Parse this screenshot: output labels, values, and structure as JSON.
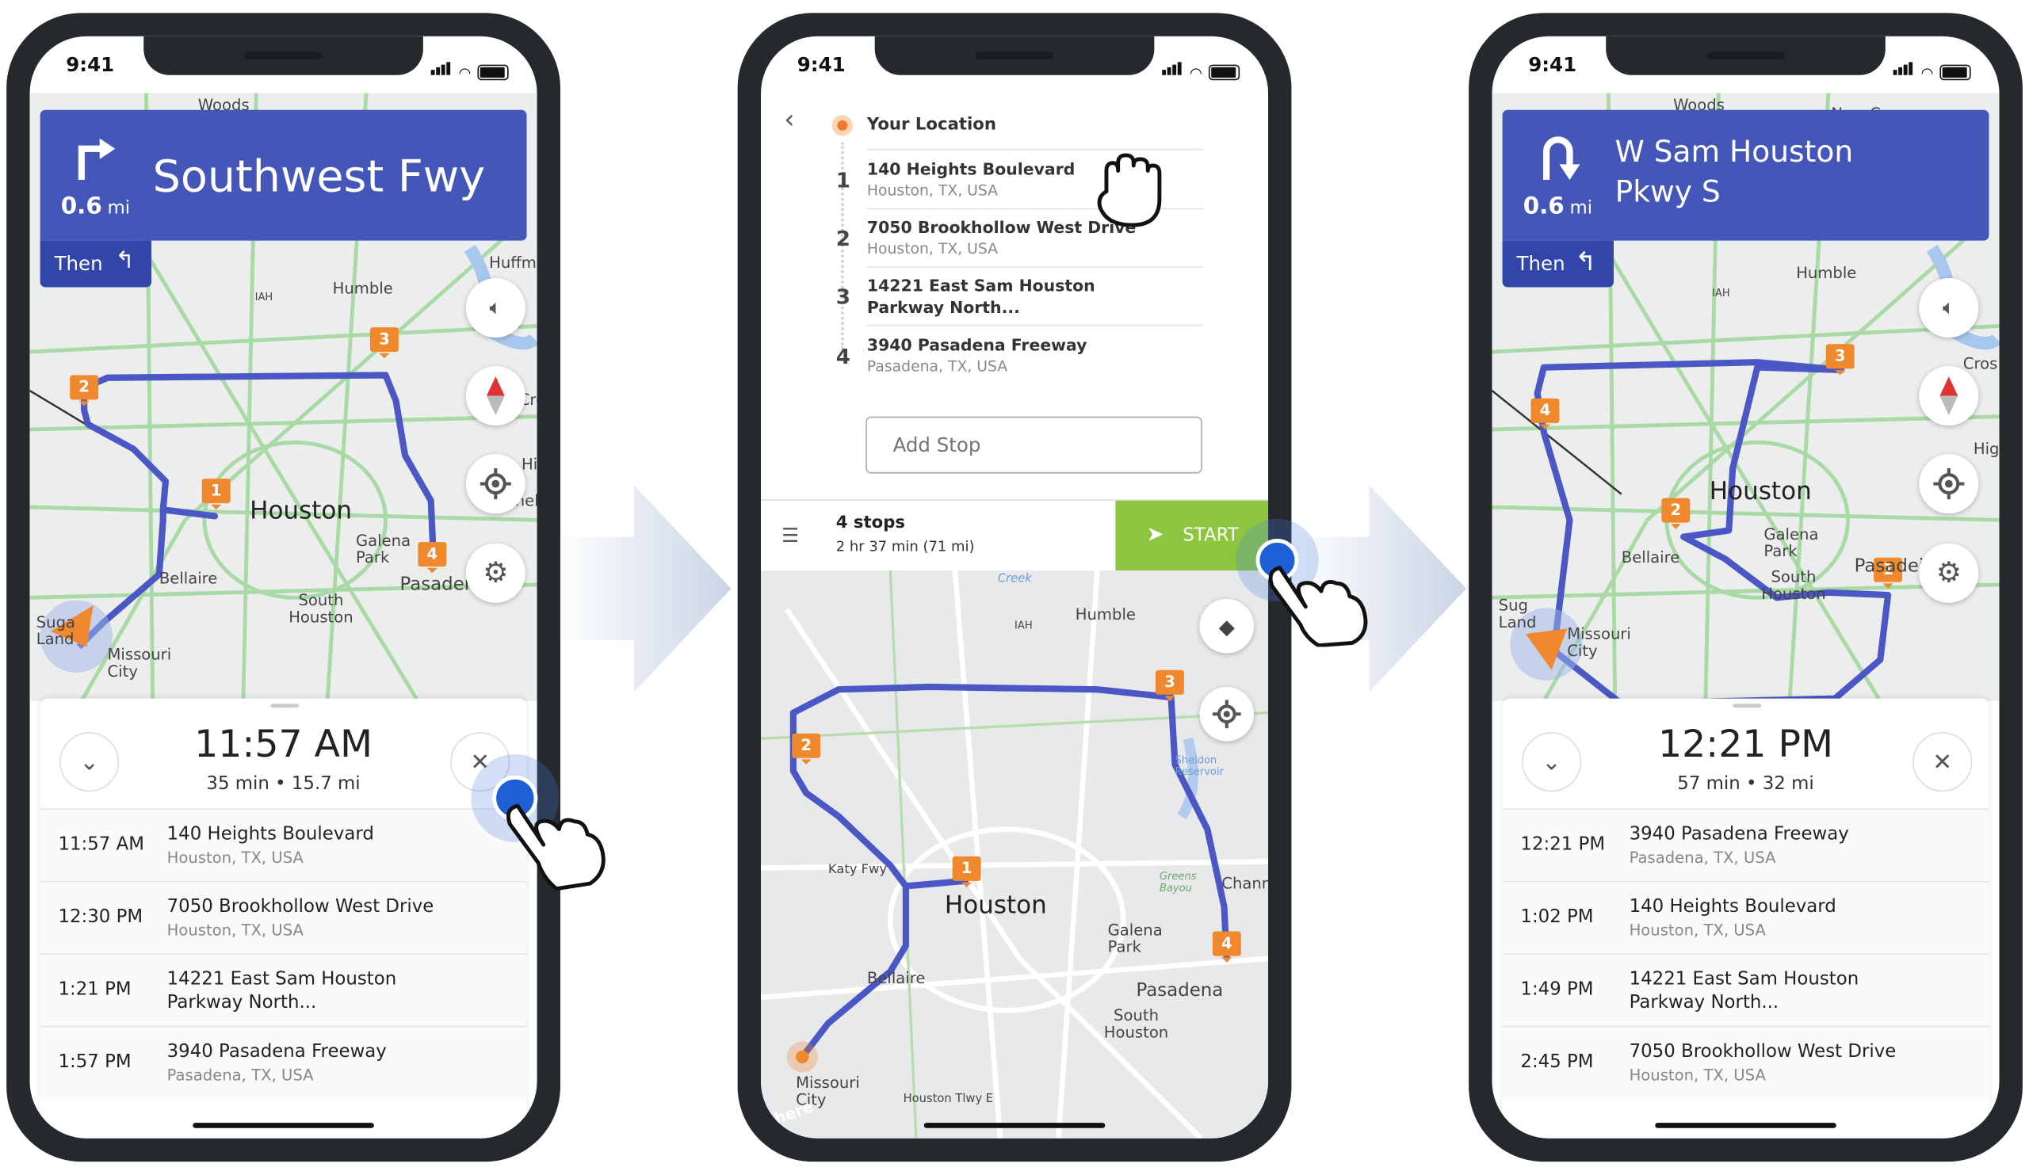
{
  "colors": {
    "banner": "#4457b9",
    "then": "#3245a9",
    "route": "#4a57c4",
    "marker": "#f0892d",
    "start": "#8cc63f",
    "road": "#a9d9a5"
  },
  "status": {
    "time": "9:41"
  },
  "phone1": {
    "maneuver": {
      "distance": "0.6",
      "unit": "mi",
      "street": "Southwest Fwy",
      "then": "Then",
      "icon": "turn-right-icon"
    },
    "map_labels": [
      "Woods",
      "Huffma",
      "Humble",
      "IAH",
      "Cros",
      "Hig",
      "Channelvie",
      "Houston",
      "Galena Park",
      "Pasadena",
      "Bellaire",
      "South Houston",
      "Suga Land",
      "Missouri City"
    ],
    "eta": {
      "time": "11:57 AM",
      "summary": "35 min • 15.7 mi"
    },
    "stops": [
      {
        "time": "11:57 AM",
        "address": "140 Heights Boulevard",
        "city": "Houston, TX, USA"
      },
      {
        "time": "12:30 PM",
        "address": "7050 Brookhollow West Drive",
        "city": "Houston, TX, USA"
      },
      {
        "time": "1:21 PM",
        "address": "14221 East Sam Houston",
        "city": "Parkway North..."
      },
      {
        "time": "1:57 PM",
        "address": "3940 Pasadena Freeway",
        "city": "Pasadena, TX, USA"
      }
    ],
    "markers": [
      "1",
      "2",
      "3",
      "4"
    ]
  },
  "phone2": {
    "origin": "Your Location",
    "stops": [
      {
        "n": "1",
        "address": "140 Heights Boulevard",
        "city": "Houston, TX, USA"
      },
      {
        "n": "2",
        "address": "7050 Brookhollow West Drive",
        "city": "Houston, TX, USA"
      },
      {
        "n": "3",
        "address": "14221 East Sam Houston",
        "city": "Parkway North..."
      },
      {
        "n": "4",
        "address": "3940 Pasadena Freeway",
        "city": "Pasadena, TX, USA"
      }
    ],
    "add_stop_placeholder": "Add Stop",
    "summary": {
      "stops": "4 stops",
      "duration": "2 hr 37 min  (71 mi)"
    },
    "start_label": "START",
    "map_labels": [
      "Humble",
      "IAH",
      "Creek",
      "Katy Fwy",
      "Houston",
      "Galena Park",
      "Bellaire",
      "Pasadena",
      "South Houston",
      "Missouri City",
      "Houston Tlwy E",
      "Greens Bayou",
      "Sheldon Reservoir",
      "Chann",
      "here"
    ],
    "markers": [
      "1",
      "2",
      "3",
      "4"
    ]
  },
  "phone3": {
    "maneuver": {
      "distance": "0.6",
      "unit": "mi",
      "street": "W Sam Houston Pkwy S",
      "then": "Then",
      "icon": "u-turn-icon"
    },
    "map_labels": [
      "Woods",
      "New Caney",
      "Humble",
      "IAH",
      "Cros",
      "Hig",
      "Houston",
      "Galena Park",
      "Pasadei",
      "Bellaire",
      "South Houston",
      "Sug Land",
      "Missouri City"
    ],
    "eta": {
      "time": "12:21 PM",
      "summary": "57 min • 32 mi"
    },
    "stops": [
      {
        "time": "12:21 PM",
        "address": "3940 Pasadena Freeway",
        "city": "Pasadena, TX, USA"
      },
      {
        "time": "1:02 PM",
        "address": "140 Heights Boulevard",
        "city": "Houston, TX, USA"
      },
      {
        "time": "1:49 PM",
        "address": "14221 East Sam Houston",
        "city": "Parkway North..."
      },
      {
        "time": "2:45 PM",
        "address": "7050 Brookhollow West Drive",
        "city": "Houston, TX, USA"
      }
    ],
    "markers": [
      "1",
      "2",
      "3",
      "4"
    ]
  }
}
